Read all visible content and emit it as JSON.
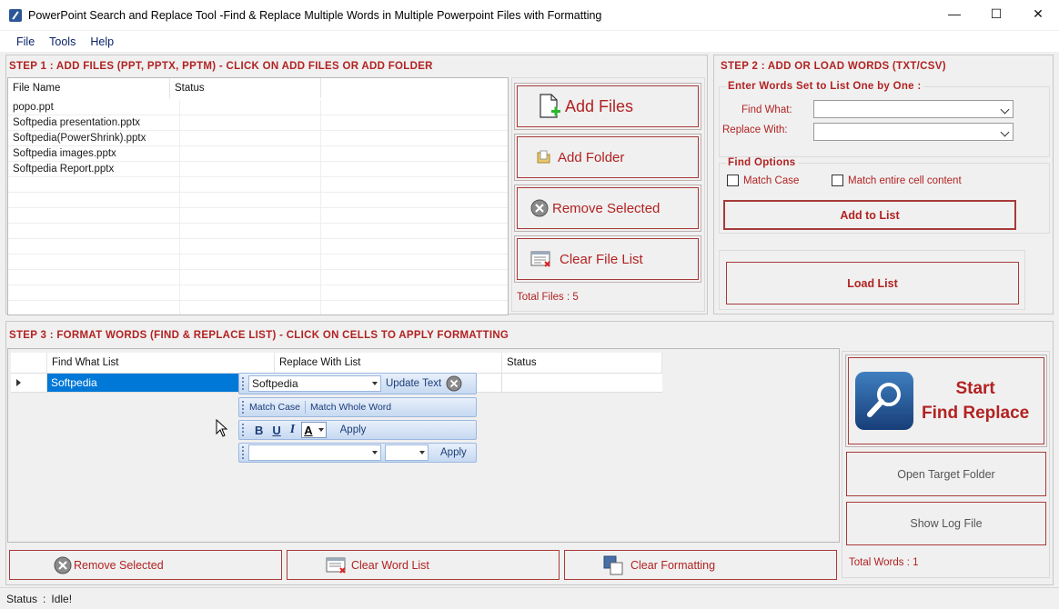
{
  "window": {
    "title": "PowerPoint Search and Replace Tool -Find & Replace Multiple Words in Multiple Powerpoint Files with Formatting",
    "minimize": "—",
    "maximize": "☐",
    "close": "✕"
  },
  "menu": [
    "File",
    "Tools",
    "Help"
  ],
  "step1": {
    "title": "STEP 1 : ADD FILES (PPT, PPTX, PPTM) - CLICK ON ADD FILES OR ADD FOLDER",
    "columns": [
      "File Name",
      "Status"
    ],
    "files": [
      "popo.ppt",
      "Softpedia presentation.pptx",
      "Softpedia(PowerShrink).pptx",
      "Softpedia images.pptx",
      "Softpedia Report.pptx"
    ],
    "buttons": {
      "add_files": "Add Files",
      "add_folder": "Add Folder",
      "remove_selected": "Remove Selected",
      "clear_file_list": "Clear File List"
    },
    "total_files": "Total Files : 5"
  },
  "step2": {
    "title": "STEP 2 : ADD OR LOAD WORDS (TXT/CSV)",
    "group_title": "Enter Words Set to List One by One :",
    "find_label": "Find What:",
    "replace_label": "Replace With:",
    "find_value": "",
    "replace_value": "",
    "options_title": "Find Options",
    "match_case": "Match Case",
    "match_entire": "Match entire cell content",
    "add_to_list": "Add to List",
    "load_list": "Load List"
  },
  "step3": {
    "title": "STEP 3 : FORMAT WORDS (FIND & REPLACE LIST) - CLICK ON CELLS TO APPLY FORMATTING",
    "columns": [
      "Find What List",
      "Replace With List",
      "Status"
    ],
    "rows": [
      {
        "find": "Softpedia",
        "replace": "",
        "status": ""
      }
    ],
    "popup": {
      "combo_value": "Softpedia",
      "update_text": "Update Text",
      "match_case": "Match Case",
      "match_whole_word": "Match Whole Word",
      "bold": "B",
      "underline": "U",
      "italic": "I",
      "font_color": "A",
      "apply": "Apply",
      "apply2": "Apply"
    },
    "buttons": {
      "remove_selected": "Remove Selected",
      "clear_word_list": "Clear Word List",
      "clear_formatting": "Clear Formatting"
    }
  },
  "actions": {
    "start_line1": "Start",
    "start_line2": "Find Replace",
    "open_target_folder": "Open Target Folder",
    "show_log_file": "Show Log File",
    "total_words": "Total Words : 1"
  },
  "status": {
    "label": "Status",
    "separator": ":",
    "value": "Idle!"
  }
}
